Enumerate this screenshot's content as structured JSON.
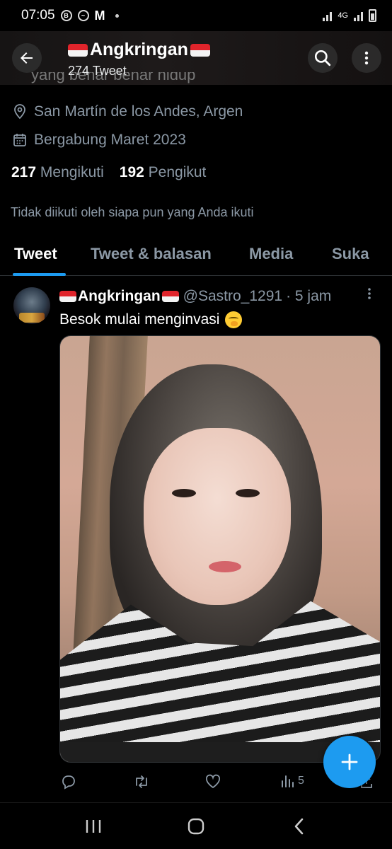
{
  "status_bar": {
    "time": "07:05",
    "network": "4G"
  },
  "header": {
    "profile_name": "Angkringan",
    "tweet_count": "274 Tweet",
    "bio_fragment": "yang benar benar hidup"
  },
  "profile": {
    "location": "San Martín de los Andes, Argen",
    "joined": "Bergabung Maret 2023",
    "following_count": "217",
    "following_label": "Mengikuti",
    "followers_count": "192",
    "followers_label": "Pengikut",
    "followed_by_note": "Tidak diikuti oleh siapa pun yang Anda ikuti"
  },
  "tabs": [
    {
      "label": "Tweet",
      "active": true
    },
    {
      "label": "Tweet & balasan",
      "active": false
    },
    {
      "label": "Media",
      "active": false
    },
    {
      "label": "Suka",
      "active": false
    }
  ],
  "tweet": {
    "author_name": "Angkringan",
    "handle": "@Sastro_1291",
    "time": "· 5 jam",
    "text": "Besok mulai menginvasi",
    "emoji": "shushing-face-emoji",
    "views": "5"
  },
  "colors": {
    "accent": "#1d9bf0",
    "muted_text": "#8b98a5",
    "flag_red": "#e0242b"
  }
}
